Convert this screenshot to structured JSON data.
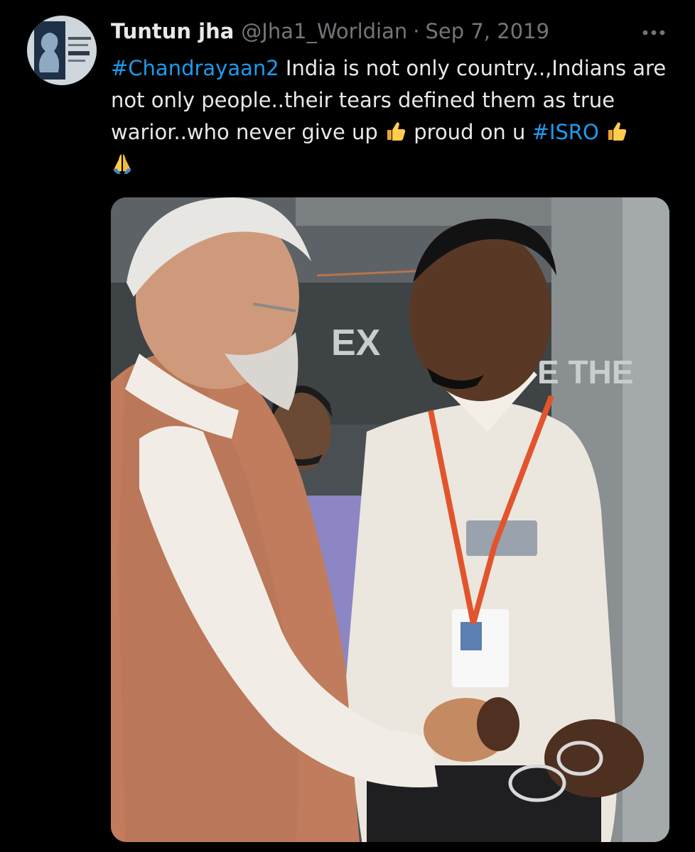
{
  "author": {
    "display_name": "Tuntun jha",
    "handle": "@Jha1_Worldian",
    "separator": "·",
    "date": "Sep 7, 2019",
    "avatar_icon": "profile-avatar"
  },
  "more_icon": "more-horizontal-icon",
  "text": {
    "hashtag_1": "#Chandrayaan2",
    "part_1": " India is not only country..,Indians are not only people..their tears defined them as true warior..who never give up ",
    "part_2": " proud on u ",
    "hashtag_2": "#ISRO",
    "emoji_1": "thumbs-up-emoji",
    "emoji_2": "thumbs-up-emoji",
    "emoji_3": "folded-hands-emoji"
  },
  "media": {
    "type": "photo",
    "sign_text_1": "EX",
    "sign_text_2": "E THE"
  },
  "colors": {
    "background": "#000000",
    "text": "#e7e9ea",
    "secondary": "#71767b",
    "link": "#1d9bf0"
  }
}
